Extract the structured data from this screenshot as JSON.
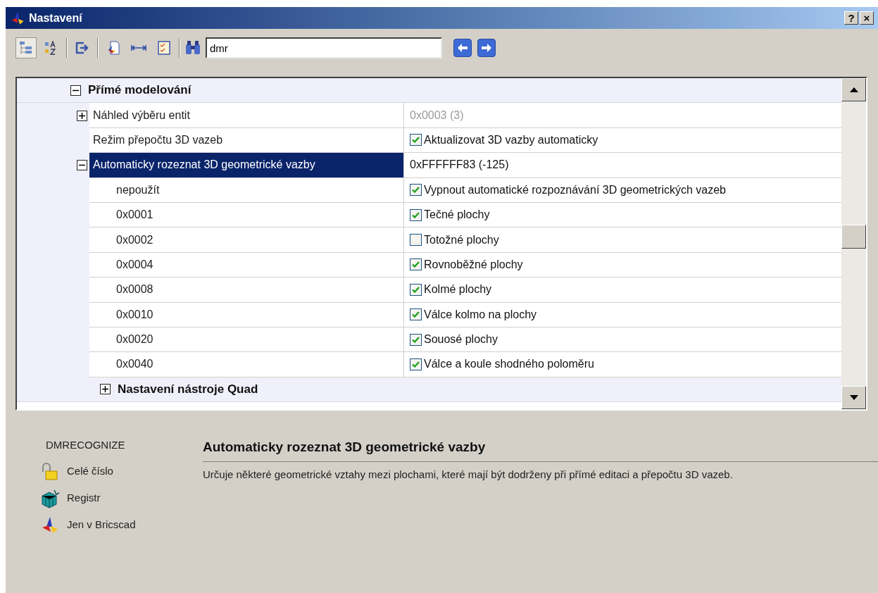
{
  "window": {
    "title": "Nastavení",
    "buttons": [
      {
        "label": "?"
      },
      {
        "label": "×"
      }
    ]
  },
  "toolbar": {
    "buttons": [
      {
        "kind": "categorized",
        "selected": true
      },
      {
        "kind": "alphabetic",
        "selected": false
      },
      {
        "kind": "export"
      },
      {
        "kind": "drawing"
      },
      {
        "kind": "width"
      },
      {
        "kind": "checklist"
      }
    ],
    "search": {
      "value": "dmr"
    },
    "nav": [
      {
        "kind": "prev"
      },
      {
        "kind": "next"
      }
    ]
  },
  "grid": {
    "categories": [
      {
        "kind": "category",
        "label": "Přímé modelování",
        "expanded": true,
        "children": [
          {
            "name": "Náhled výběru entit",
            "expanded": false,
            "value": "0x0003 (3)",
            "disabled": true
          },
          {
            "name": "Režim přepočtu 3D vazeb",
            "value": "Aktualizovat 3D vazby automaticky",
            "checked": true
          },
          {
            "name": "Automaticky rozeznat 3D geometrické vazby",
            "expanded": true,
            "selected": true,
            "value": "0xFFFFFF83 (-125)",
            "children": [
              {
                "name": "nepoužít",
                "value": "Vypnout automatické rozpoznávání 3D geometrických vazeb",
                "checked": true
              },
              {
                "name": "0x0001",
                "value": "Tečné plochy",
                "checked": true
              },
              {
                "name": "0x0002",
                "value": "Totožné plochy",
                "checked": false
              },
              {
                "name": "0x0004",
                "value": "Rovnoběžné plochy",
                "checked": true
              },
              {
                "name": "0x0008",
                "value": "Kolmé plochy",
                "checked": true
              },
              {
                "name": "0x0010",
                "value": "Válce kolmo na plochy",
                "checked": true
              },
              {
                "name": "0x0020",
                "value": "Souosé plochy",
                "checked": true
              },
              {
                "name": "0x0040",
                "value": "Válce a koule shodného poloměru",
                "checked": true
              }
            ]
          }
        ]
      },
      {
        "kind": "subcategory",
        "label": "Nastavení nástroje Quad",
        "expanded": false
      }
    ]
  },
  "info": {
    "variable": "DMRECOGNIZE",
    "attributes": [
      {
        "kind": "integer",
        "label": "Celé číslo"
      },
      {
        "kind": "registry",
        "label": "Registr"
      },
      {
        "kind": "bricscad",
        "label": "Jen v Bricscad"
      }
    ],
    "title": "Automaticky rozeznat 3D geometrické vazby",
    "description": "Určuje některé geometrické vztahy mezi plochami, které mají být dodrženy při přímé editaci a přepočtu 3D vazeb."
  }
}
